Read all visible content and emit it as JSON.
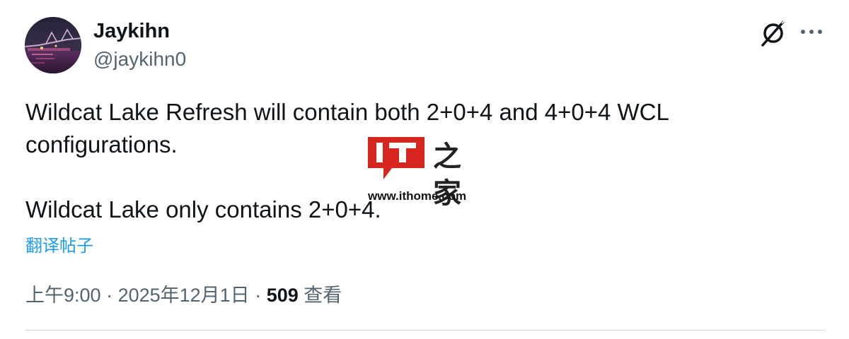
{
  "author": {
    "display_name": "Jaykihn",
    "handle": "@jaykihn0"
  },
  "header": {
    "grok_icon": "grok-slash-icon",
    "more_icon": "more-dots-icon"
  },
  "tweet": {
    "paragraphs": [
      "Wildcat Lake Refresh will contain both 2+0+4 and 4+0+4 WCL configurations.",
      "Wildcat Lake only contains 2+0+4."
    ],
    "translate_label": "翻译帖子"
  },
  "meta": {
    "time": "上午9:00",
    "separator": " · ",
    "date": "2025年12月1日",
    "views_count": "509",
    "views_label": " 查看"
  },
  "watermark": {
    "logo_letters": "IT",
    "logo_chars": "之家",
    "url": "www.ithome.com"
  },
  "colors": {
    "link": "#1d9bf0",
    "secondary_text": "#536471",
    "primary_text": "#0f1419",
    "logo_red": "#d7261e"
  }
}
